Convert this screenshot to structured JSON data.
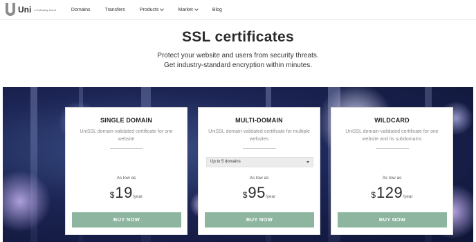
{
  "nav": {
    "logo_text": "Uni",
    "logo_sub": "a GoDaddy brand",
    "links": [
      {
        "label": "Domains",
        "has_menu": false
      },
      {
        "label": "Transfers",
        "has_menu": false
      },
      {
        "label": "Products",
        "has_menu": true
      },
      {
        "label": "Market",
        "has_menu": true
      },
      {
        "label": "Blog",
        "has_menu": false
      }
    ]
  },
  "hero": {
    "title": "SSL certificates",
    "subtitle_line1": "Protect your website and users from security threats.",
    "subtitle_line2": "Get industry-standard encryption within minutes."
  },
  "cards": [
    {
      "title": "SINGLE DOMAIN",
      "description": "UniSSL domain-validated certificate for one website",
      "as_low_as": "As low as",
      "currency": "$",
      "price": "19",
      "period": "/year",
      "button": "BUY NOW"
    },
    {
      "title": "MULTI-DOMAIN",
      "description": "UniSSL domain-validated certificate for multiple websites",
      "dropdown_value": "Up to 5 domains",
      "as_low_as": "As low as",
      "currency": "$",
      "price": "95",
      "period": "/year",
      "button": "BUY NOW"
    },
    {
      "title": "WILDCARD",
      "description": "UniSSL domain-validated certificate for one website and its subdomains",
      "as_low_as": "As low as",
      "currency": "$",
      "price": "129",
      "period": "/year",
      "button": "BUY NOW"
    }
  ],
  "colors": {
    "buy_button": "#8db5a0",
    "banner_dark": "#1b2453",
    "text_muted": "#8a8a8a"
  }
}
